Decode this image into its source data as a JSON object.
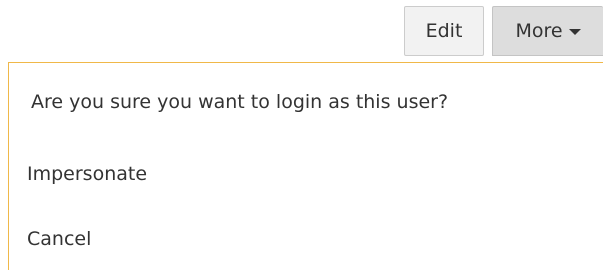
{
  "toolbar": {
    "edit_label": "Edit",
    "more_label": "More"
  },
  "dropdown": {
    "confirm_text": "Are you sure you want to login as this user?",
    "items": [
      {
        "label": "Impersonate"
      },
      {
        "label": "Cancel"
      }
    ]
  },
  "colors": {
    "menu_border": "#f0b849",
    "button_bg": "#f2f2f2",
    "button_active_bg": "#dddddd"
  },
  "icons": {
    "more_caret": "caret-down-icon"
  }
}
